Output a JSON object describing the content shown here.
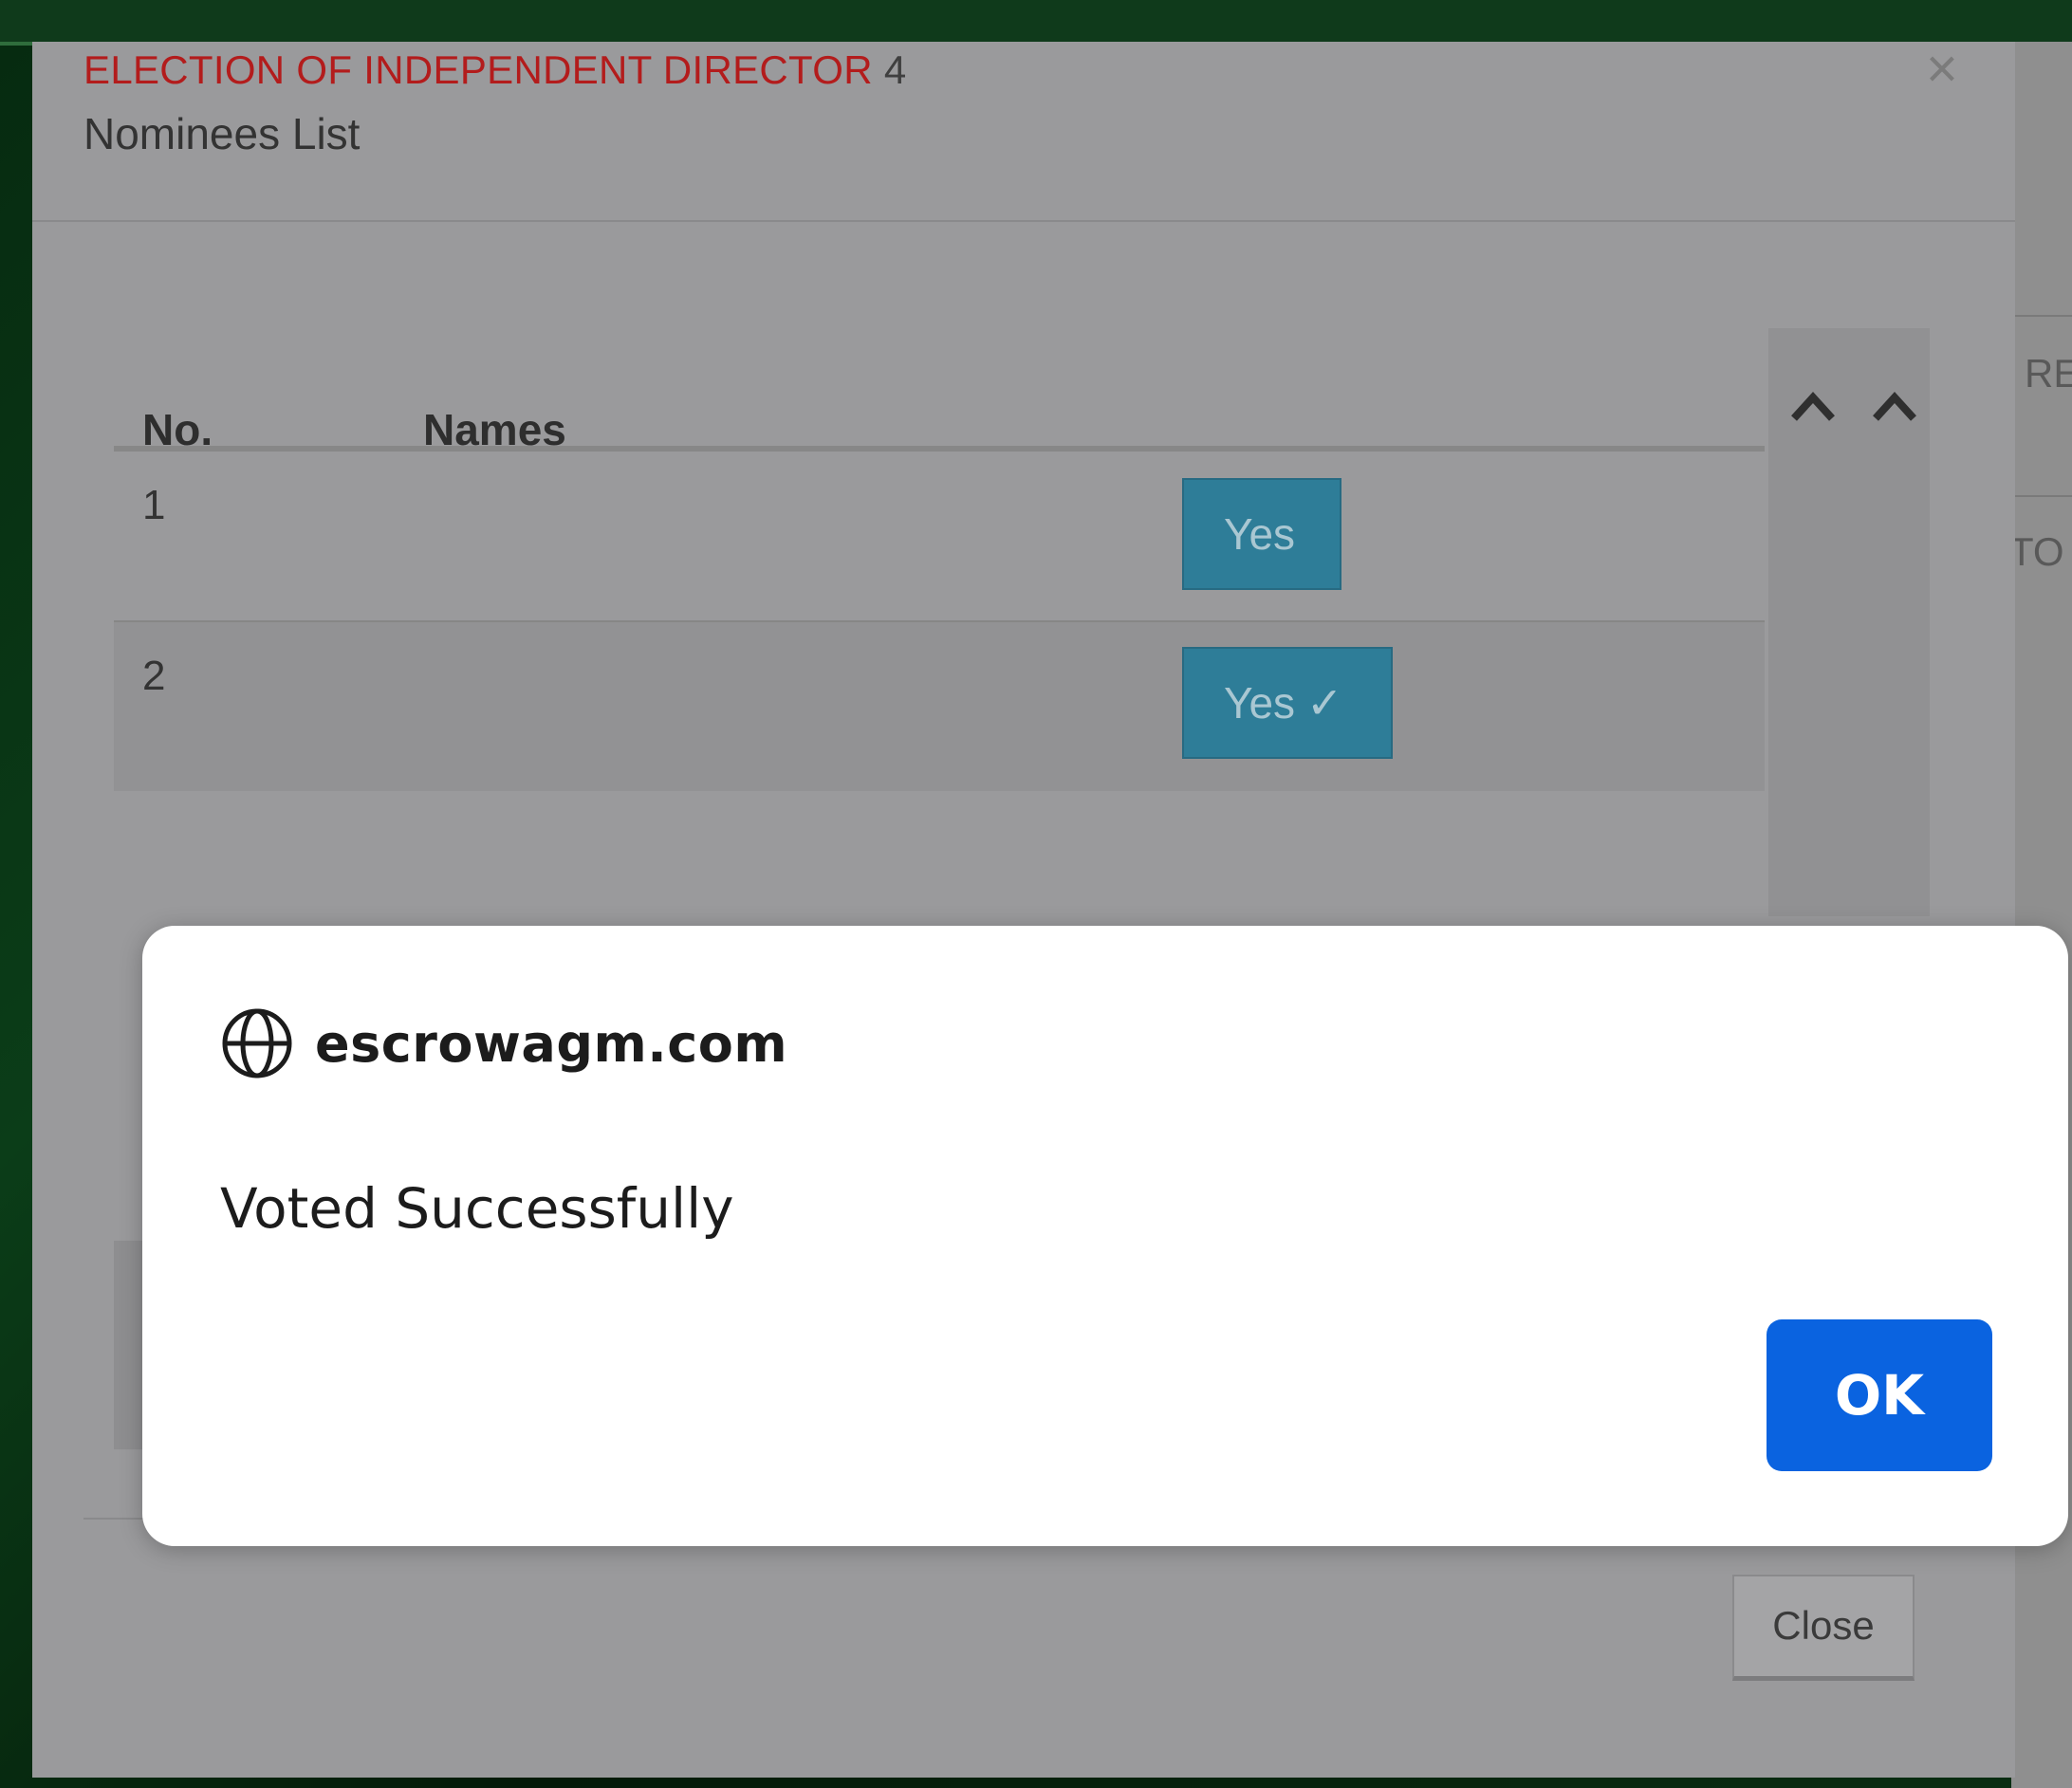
{
  "modal": {
    "title": "ELECTION OF INDEPENDENT DIRECTOR",
    "title_suffix": "4",
    "subtitle": "Nominees List",
    "close_x": "×",
    "close_button": "Close",
    "table": {
      "headers": [
        "No.",
        "Names"
      ],
      "rows": [
        {
          "no": "1",
          "name": "",
          "vote_label": "Yes",
          "voted": false
        },
        {
          "no": "2",
          "name": "",
          "vote_label": "Yes",
          "voted": true,
          "check": "✓"
        }
      ]
    },
    "scroll_controls": [
      "chevron-up-icon",
      "chevron-up-icon"
    ]
  },
  "background": {
    "right_text_1": "RE",
    "right_text_2": "TO"
  },
  "alert": {
    "icon": "globe-icon",
    "origin": "escrowagm.com",
    "message": "Voted Successfully",
    "ok_label": "OK"
  },
  "colors": {
    "title_red": "#b31c1c",
    "yes_button": "#2e7d98",
    "ok_button": "#0a63e0"
  }
}
